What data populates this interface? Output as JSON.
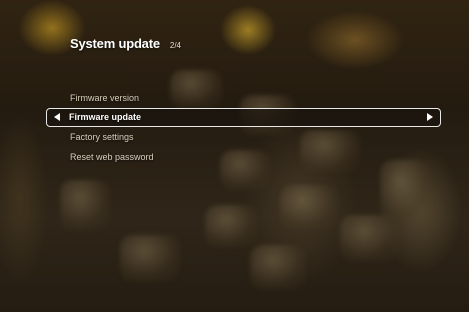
{
  "header": {
    "title": "System update",
    "page_indicator": "2/4"
  },
  "menu": {
    "items": [
      {
        "label": "Firmware version",
        "selected": false
      },
      {
        "label": "Firmware update",
        "selected": true
      },
      {
        "label": "Factory settings",
        "selected": false
      },
      {
        "label": "Reset web password",
        "selected": false
      }
    ]
  },
  "icons": {
    "left": "arrow-left-icon",
    "right": "arrow-right-icon"
  },
  "colors": {
    "highlight_border": "#e8e8e8",
    "text_selected": "#ffffff",
    "text_normal": "#d8d0bc"
  }
}
